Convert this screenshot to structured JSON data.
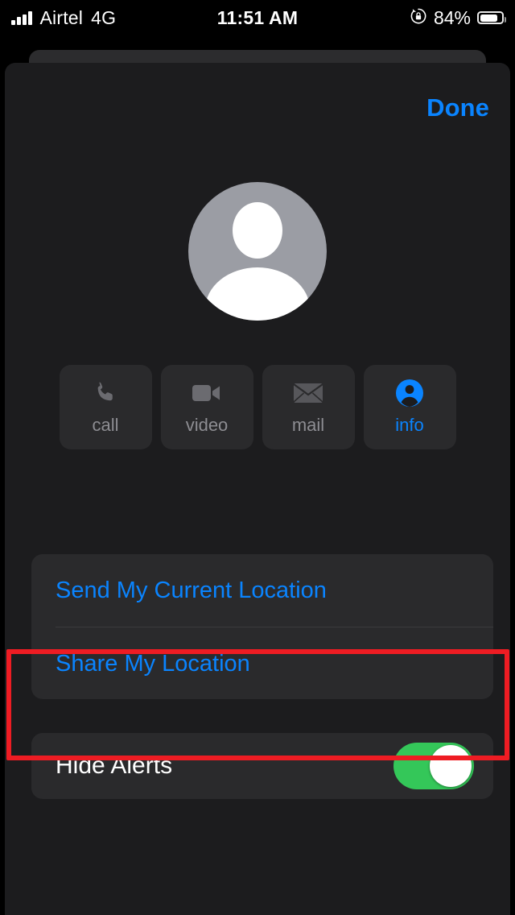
{
  "status_bar": {
    "carrier": "Airtel",
    "network": "4G",
    "time": "11:51 AM",
    "battery_percent": "84%",
    "battery_level": 84,
    "signal_bars": 4,
    "rotation_lock_icon": "rotation-lock-icon",
    "battery_icon": "battery-icon",
    "signal_icon": "cellular-signal-icon"
  },
  "sheet": {
    "done_label": "Done",
    "avatar_icon": "default-contact-avatar-icon"
  },
  "actions": [
    {
      "id": "call",
      "label": "call",
      "icon": "phone-icon",
      "state": "inactive"
    },
    {
      "id": "video",
      "label": "video",
      "icon": "video-camera-icon",
      "state": "inactive"
    },
    {
      "id": "mail",
      "label": "mail",
      "icon": "envelope-icon",
      "state": "inactive"
    },
    {
      "id": "info",
      "label": "info",
      "icon": "person-circle-icon",
      "state": "active"
    }
  ],
  "location_group": {
    "send_current_label": "Send My Current Location",
    "share_label": "Share My Location"
  },
  "alerts_group": {
    "hide_alerts_label": "Hide Alerts",
    "hide_alerts_on": true,
    "toggle_state": "on"
  },
  "annotation": {
    "shape": "rectangle",
    "color": "#EE1C23",
    "target": "hide-alerts-row"
  },
  "colors": {
    "accent_blue": "#0A84FF",
    "toggle_green": "#34C759",
    "sheet_bg": "#1C1C1E",
    "card_bg": "#2A2A2C",
    "annotation_red": "#EE1C23",
    "label_gray": "#8D8D92"
  }
}
